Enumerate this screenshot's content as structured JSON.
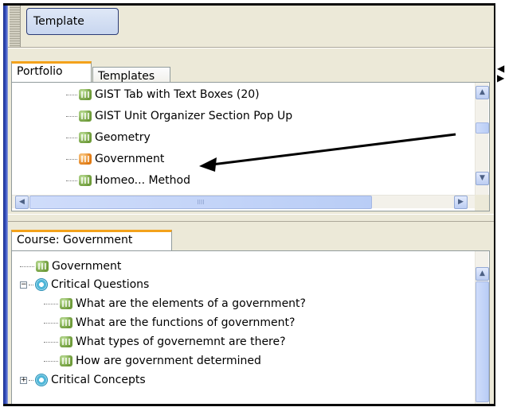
{
  "toolbar": {
    "template_button": "Template"
  },
  "top_panel": {
    "tabs": [
      {
        "label": "Portfolio",
        "active": true
      },
      {
        "label": "Templates",
        "active": false
      }
    ],
    "items": [
      {
        "label": "GIST Tab with Text Boxes (20)",
        "icon": "green-node-icon"
      },
      {
        "label": "GIST Unit Organizer Section Pop Up",
        "icon": "green-node-icon"
      },
      {
        "label": "Geometry",
        "icon": "green-node-icon"
      },
      {
        "label": "Government",
        "icon": "orange-node-icon",
        "selected": true
      },
      {
        "label": "Homeo... Method",
        "icon": "green-node-icon"
      }
    ],
    "scroll_up": "▲",
    "scroll_down": "▼",
    "scroll_left": "◀",
    "scroll_right": "▶",
    "hgrip": "IIII"
  },
  "bottom_panel": {
    "tab": "Course: Government",
    "items": [
      {
        "label": "Government",
        "icon": "green-node-icon"
      },
      {
        "label": "Critical Questions",
        "icon": "gear-icon",
        "expander": "−"
      },
      {
        "label": "What are the elements of a government?",
        "icon": "green-node-icon"
      },
      {
        "label": "What are the functions of government?",
        "icon": "green-node-icon"
      },
      {
        "label": "What types of governemnt are there?",
        "icon": "green-node-icon"
      },
      {
        "label": "How are government determined",
        "icon": "green-node-icon"
      },
      {
        "label": "Critical Concepts",
        "icon": "gear-icon",
        "expander": "+"
      }
    ],
    "scroll_up": "▲"
  },
  "annotation": {
    "type": "arrow",
    "points_to": "Government"
  },
  "colors": {
    "panel_bg": "#ece9d8",
    "active_tab_accent": "#f3a21b",
    "scrollbar_blue": "#bccdf2"
  }
}
